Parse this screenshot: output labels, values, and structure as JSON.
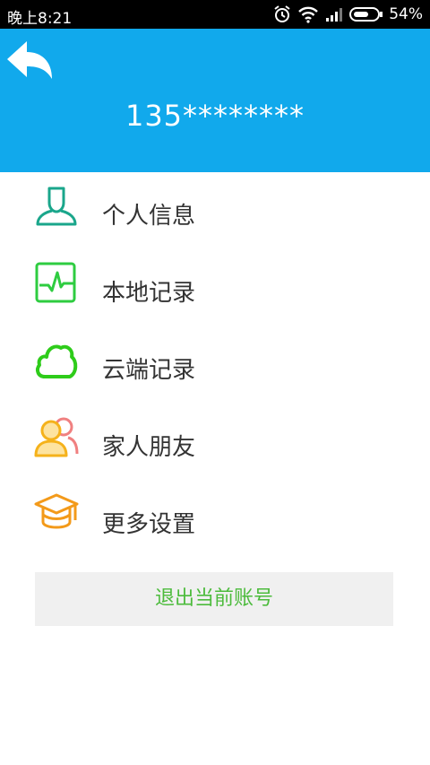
{
  "status_bar": {
    "time": "晚上8:21",
    "battery": "54%"
  },
  "header": {
    "phone": "135********"
  },
  "menu": [
    {
      "label": "个人信息",
      "icon": "person-icon",
      "color": "#1aa68b"
    },
    {
      "label": "本地记录",
      "icon": "pulse-icon",
      "color": "#2ecc40"
    },
    {
      "label": "云端记录",
      "icon": "cloud-icon",
      "color": "#2ecc1a"
    },
    {
      "label": "家人朋友",
      "icon": "family-icon",
      "color": "#f5b21b"
    },
    {
      "label": "更多设置",
      "icon": "graduation-cap-icon",
      "color": "#f39a1a"
    }
  ],
  "logout_label": "退出当前账号",
  "colors": {
    "header_bg": "#11a9ec",
    "logout_text": "#4cbb3c"
  }
}
